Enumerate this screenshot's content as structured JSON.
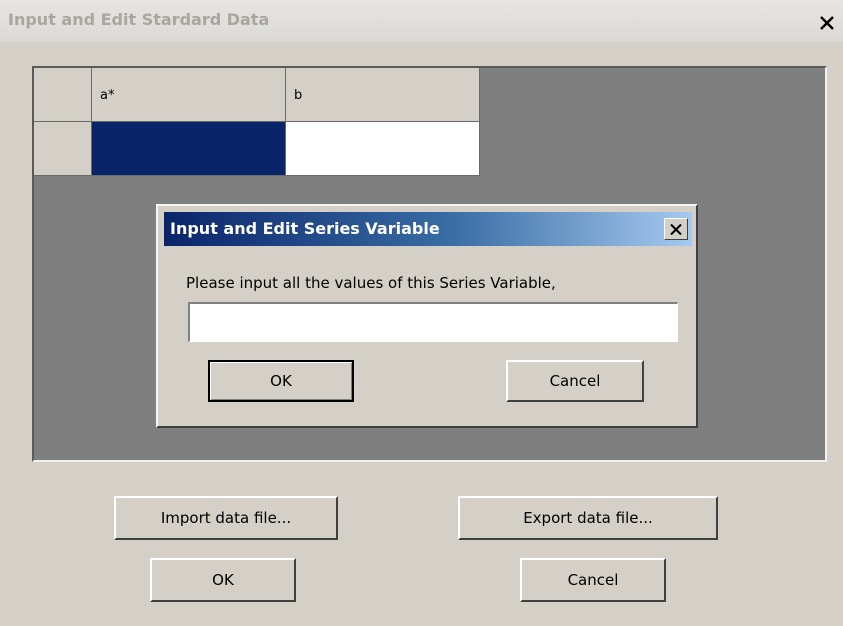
{
  "main_window": {
    "title": "Input and Edit Stardard Data"
  },
  "grid": {
    "columns": [
      "a*",
      "b"
    ]
  },
  "dialog": {
    "title": "Input and Edit Series Variable",
    "prompt": "Please input all the values of this Series Variable,",
    "input_value": "",
    "ok_label": "OK",
    "cancel_label": "Cancel"
  },
  "footer": {
    "import_label": "Import data file...",
    "export_label": "Export data file...",
    "ok_label": "OK",
    "cancel_label": "Cancel"
  },
  "colors": {
    "selection": "#0a246a",
    "dialog_title_gradient_start": "#0a246a",
    "dialog_title_gradient_end": "#a6caf0",
    "panel_background": "#7f7f7f",
    "face": "#d4d0c8"
  },
  "icons": {
    "main_close": "close-icon",
    "dialog_close": "close-icon"
  }
}
